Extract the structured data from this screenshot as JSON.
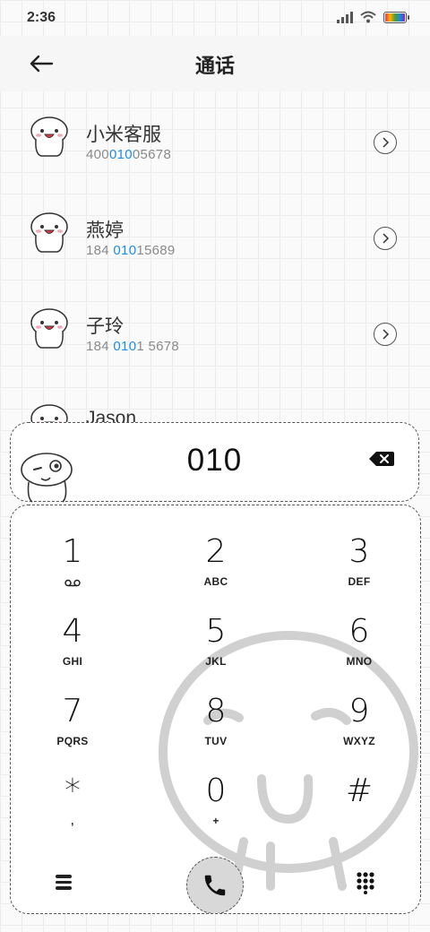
{
  "status_bar": {
    "time": "2:36",
    "icons": [
      "signal-icon",
      "wifi-icon",
      "battery-icon"
    ]
  },
  "header": {
    "title": "通话",
    "back_icon": "back-arrow-icon"
  },
  "contacts": [
    {
      "name": "小米客服",
      "number_parts": [
        {
          "text": "400",
          "hl": false
        },
        {
          "text": "010",
          "hl": true
        },
        {
          "text": "05678",
          "hl": false
        }
      ]
    },
    {
      "name": "燕婷",
      "number_parts": [
        {
          "text": "184 ",
          "hl": false
        },
        {
          "text": "010",
          "hl": true
        },
        {
          "text": "15689",
          "hl": false
        }
      ]
    },
    {
      "name": "子玲",
      "number_parts": [
        {
          "text": "184 ",
          "hl": false
        },
        {
          "text": "010",
          "hl": true
        },
        {
          "text": "1 5678",
          "hl": false
        }
      ]
    },
    {
      "name": "Jason",
      "number_parts": []
    }
  ],
  "dialer": {
    "dialed_number": "010",
    "backspace_icon": "backspace-icon"
  },
  "keypad": {
    "keys": [
      {
        "digit": "1",
        "letters": "",
        "sub_icon": "voicemail-icon"
      },
      {
        "digit": "2",
        "letters": "ABC"
      },
      {
        "digit": "3",
        "letters": "DEF"
      },
      {
        "digit": "4",
        "letters": "GHI"
      },
      {
        "digit": "5",
        "letters": "JKL"
      },
      {
        "digit": "6",
        "letters": "MNO"
      },
      {
        "digit": "7",
        "letters": "PQRS"
      },
      {
        "digit": "8",
        "letters": "TUV"
      },
      {
        "digit": "9",
        "letters": "WXYZ"
      },
      {
        "digit": "*",
        "letters": ","
      },
      {
        "digit": "0",
        "letters": "+"
      },
      {
        "digit": "#",
        "letters": ""
      }
    ],
    "menu_icon": "menu-icon",
    "call_icon": "phone-icon",
    "dialpad_icon": "dialpad-icon"
  },
  "colors": {
    "highlight": "#1d8ee6",
    "text": "#222222",
    "subtext": "#8a8a8a"
  }
}
